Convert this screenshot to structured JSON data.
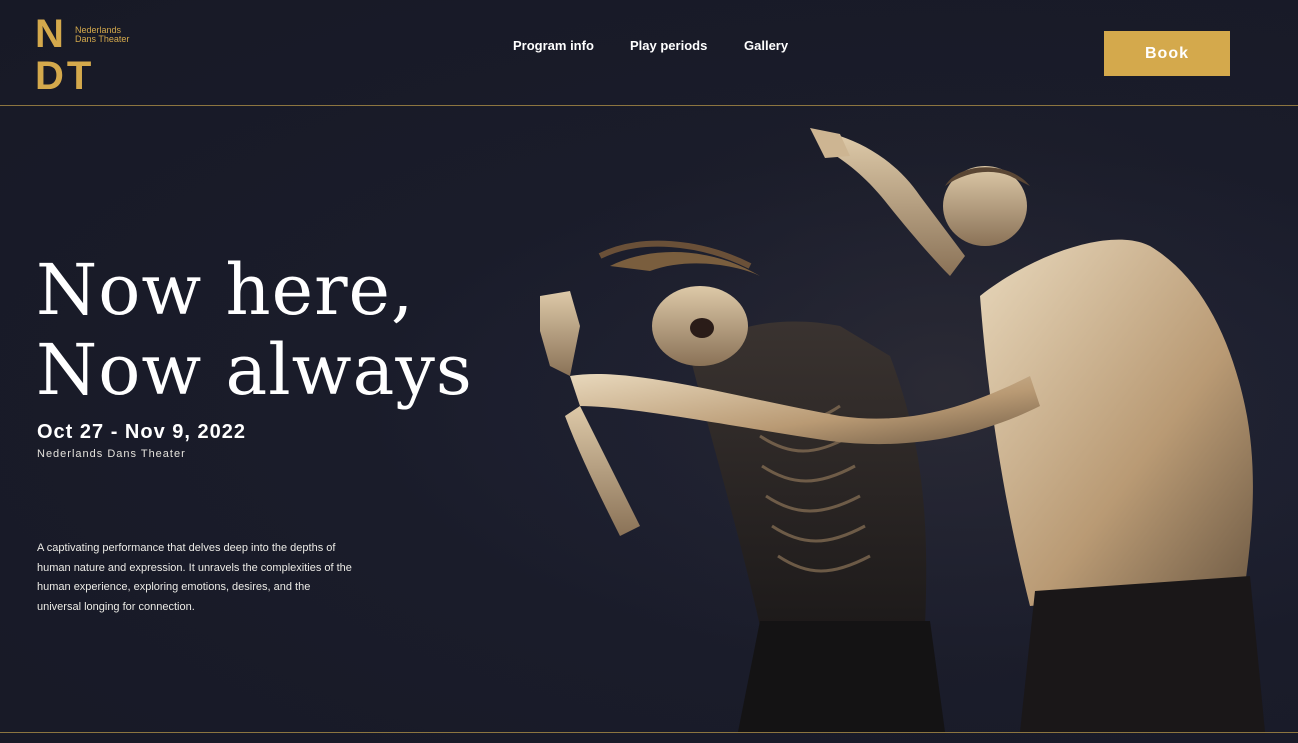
{
  "brand": {
    "logo_letters_top": "N",
    "logo_letters_bottom": "DT",
    "logo_line1": "Nederlands",
    "logo_line2": "Dans Theater",
    "accent_color": "#d4a94c",
    "background_color": "#191b28"
  },
  "nav": {
    "items": [
      {
        "label": "Program info"
      },
      {
        "label": "Play periods"
      },
      {
        "label": "Gallery"
      }
    ],
    "book_label": "Book"
  },
  "hero": {
    "title_line1": "Now here,",
    "title_line2": "Now always",
    "dates": "Oct 27 - Nov 9, 2022",
    "company": "Nederlands Dans Theater",
    "description": "A captivating performance that delves deep into the depths of human nature and expression. It unravels the complexities of the human experience, exploring emotions, desires, and the universal longing for connection."
  }
}
